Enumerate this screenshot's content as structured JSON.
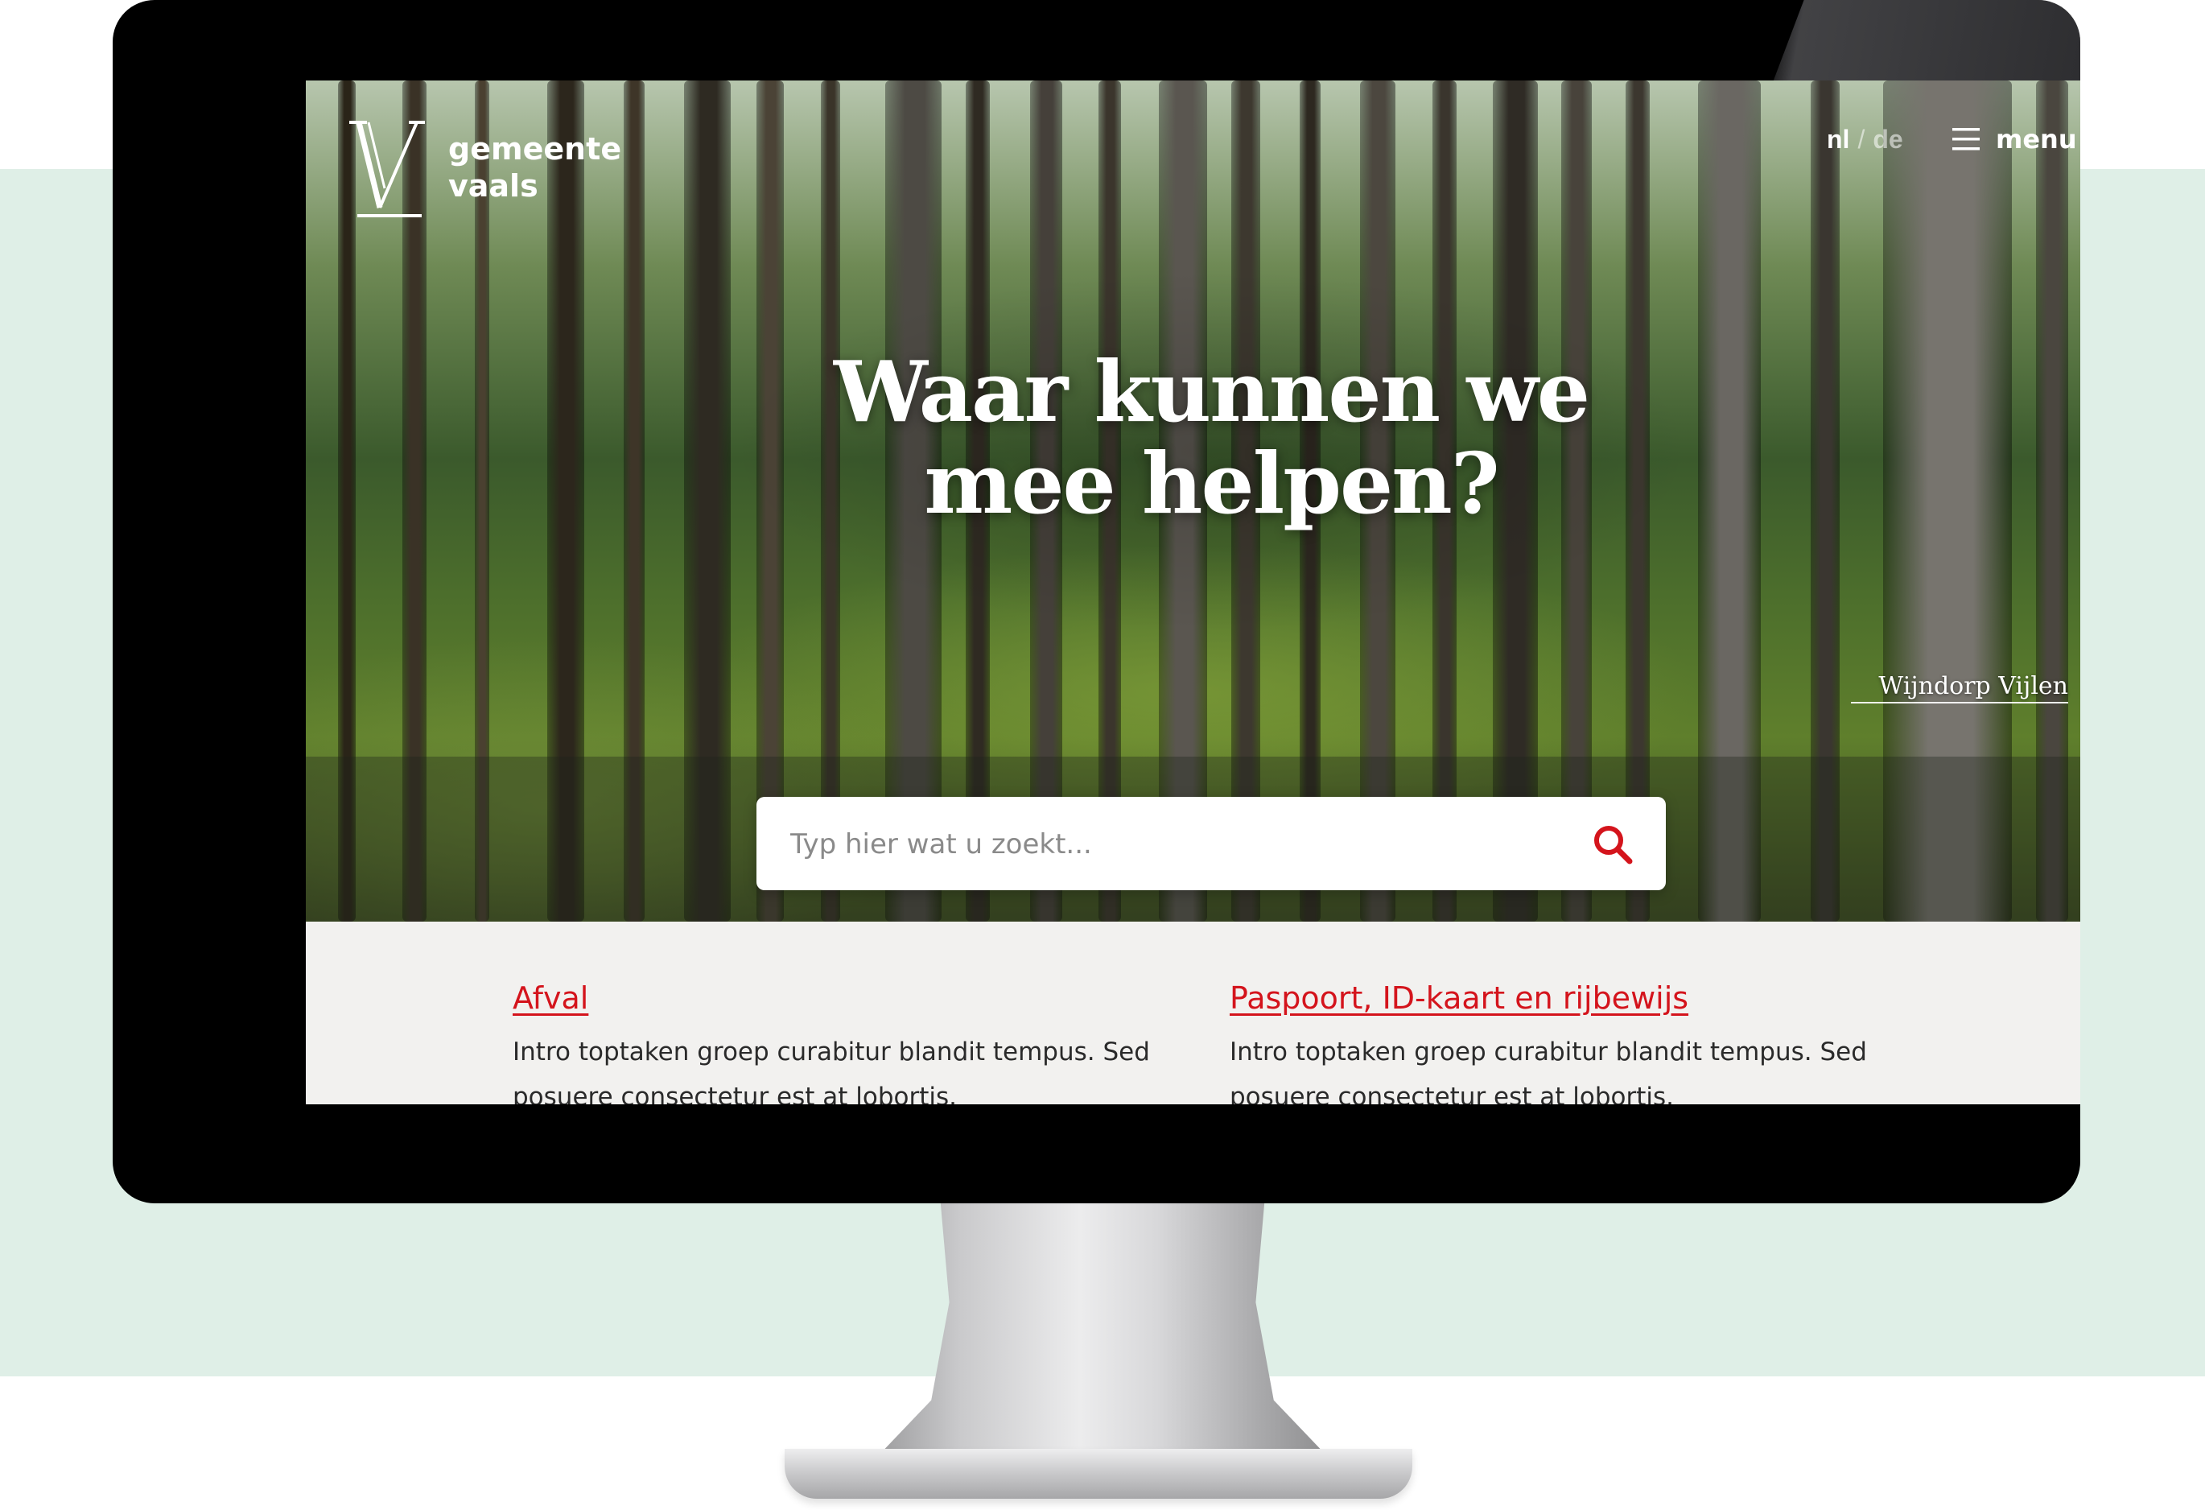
{
  "brand": {
    "name_line1": "gemeente",
    "name_line2": "vaals",
    "logo_icon": "vaals-v-logo-icon"
  },
  "header": {
    "languages": [
      "nl",
      "de"
    ],
    "language_separator": "/",
    "active_language": "nl",
    "menu_label": "menu",
    "menu_icon": "hamburger-icon"
  },
  "hero": {
    "title_line1": "Waar kunnen we",
    "title_line2": "mee helpen?",
    "photo_caption": "Wijndorp Vijlen"
  },
  "search": {
    "placeholder": "Typ hier wat u zoekt...",
    "value": "",
    "icon": "search-icon"
  },
  "tasks": [
    {
      "title": "Afval",
      "intro": "Intro toptaken groep curabitur blandit tempus. Sed posuere consectetur est at lobortis."
    },
    {
      "title": "Paspoort, ID-kaart en rijbewijs",
      "intro": "Intro toptaken groep curabitur blandit tempus. Sed posuere consectetur est at lobortis."
    }
  ],
  "colors": {
    "accent_red": "#d4141c",
    "mint_background": "#dfefe7",
    "content_background": "#f2f1ef",
    "bezel": "#000000"
  }
}
